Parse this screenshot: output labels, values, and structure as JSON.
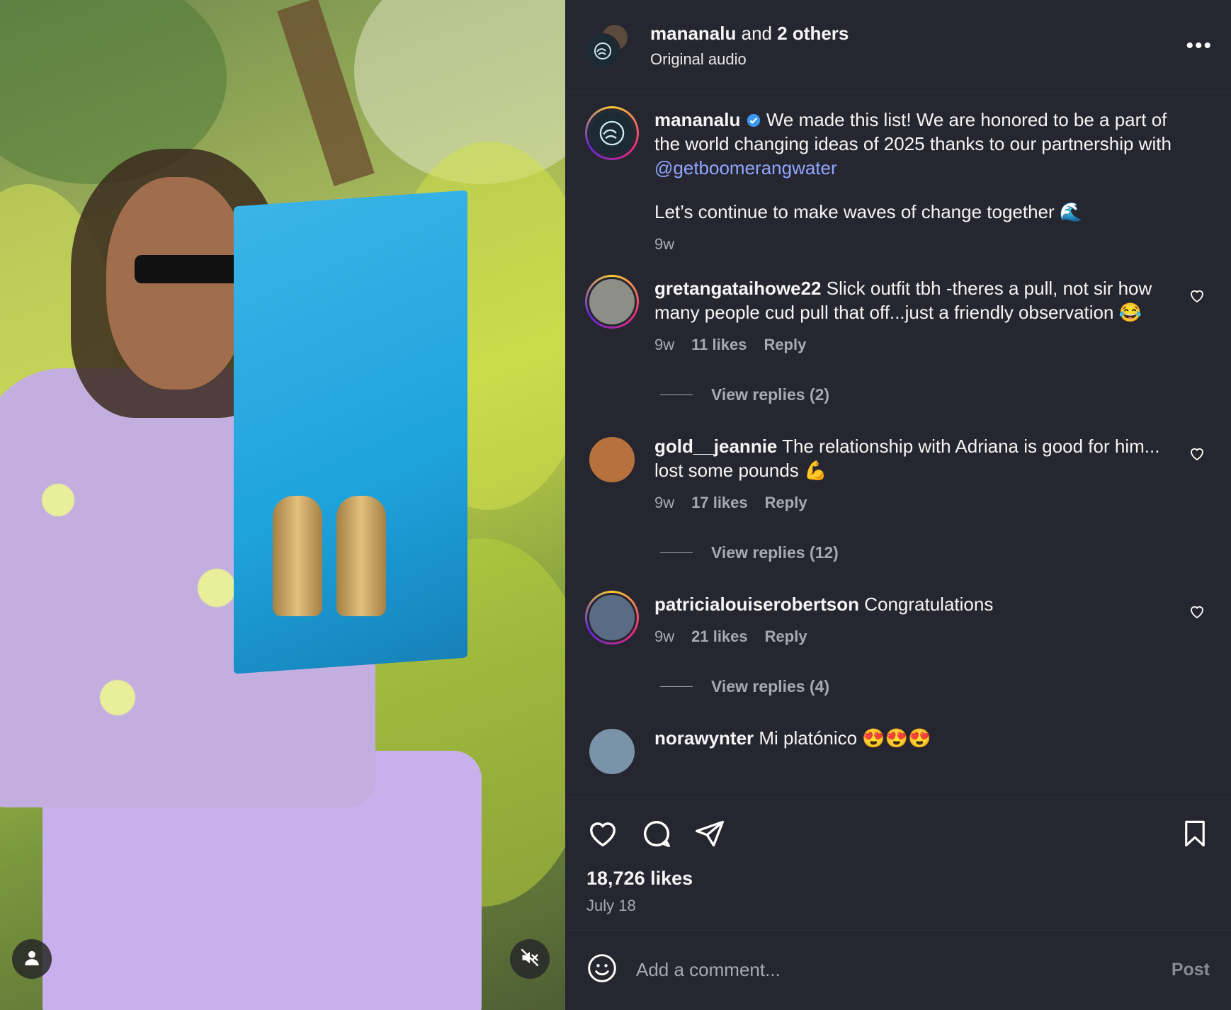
{
  "header": {
    "author": "mananalu",
    "and_text": "and",
    "others": "2 others",
    "audio": "Original audio",
    "more": "•••"
  },
  "caption": {
    "user": "mananalu",
    "text": "We made this list! We are honored to be a part of the world changing ideas of 2025 thanks to our partnership with",
    "mention": "@getboomerangwater",
    "text2": "Let’s continue to make waves of change together 🌊",
    "time": "9w"
  },
  "comments": [
    {
      "user": "gretangataihowe22",
      "text": "Slick outfit tbh -theres a pull, not sir how many people cud pull that off...just a friendly observation 😂",
      "time": "9w",
      "likes": "11 likes",
      "reply": "Reply",
      "view_replies": "View replies (2)"
    },
    {
      "user": "gold__jeannie",
      "text": "The relationship with Adriana is good for him... lost some pounds 💪",
      "time": "9w",
      "likes": "17 likes",
      "reply": "Reply",
      "view_replies": "View replies (12)"
    },
    {
      "user": "patricialouiserobertson",
      "text": "Congratulations",
      "time": "9w",
      "likes": "21 likes",
      "reply": "Reply",
      "view_replies": "View replies (4)"
    },
    {
      "user": "norawynter",
      "text": "Mi platónico 😍😍😍"
    }
  ],
  "stats": {
    "likes": "18,726 likes",
    "date": "July 18"
  },
  "composer": {
    "placeholder": "Add a comment...",
    "post": "Post"
  },
  "colors": {
    "panel_bg": "#262630",
    "mention": "#8ea6ff",
    "muted": "#a8a8b0"
  },
  "icons": [
    "heart-icon",
    "comment-icon",
    "share-icon",
    "bookmark-icon",
    "emoji-icon",
    "user-icon",
    "mute-icon",
    "verified-icon"
  ]
}
